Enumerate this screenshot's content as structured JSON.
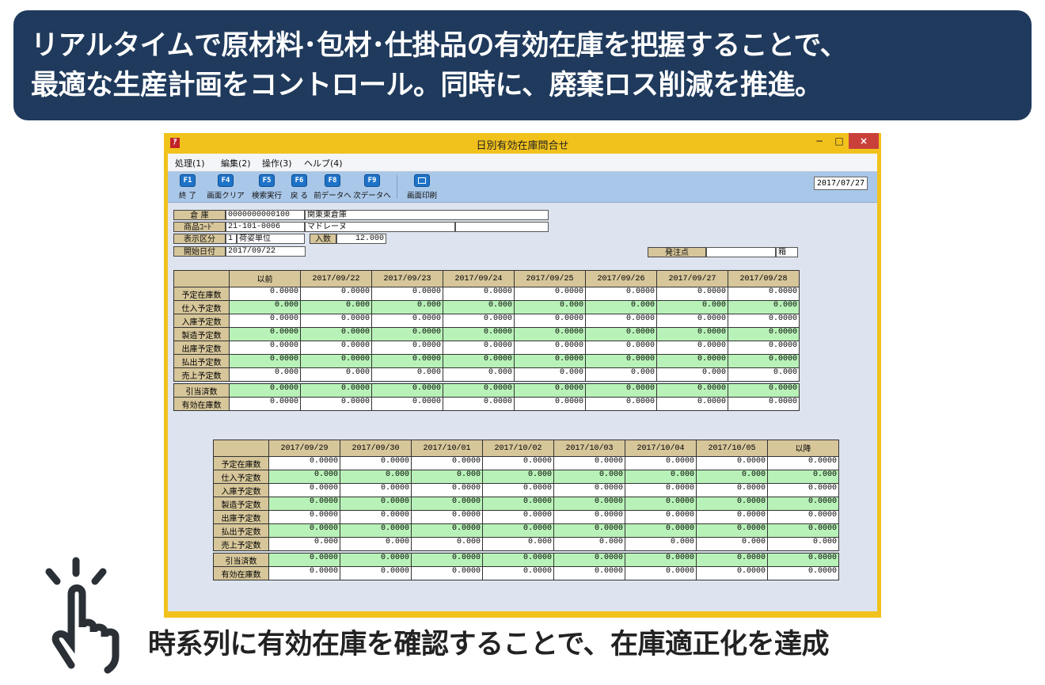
{
  "headline": {
    "line1": "リアルタイムで原材料･包材･仕掛品の有効在庫を把握することで、",
    "line2": "最適な生産計画をコントロール。同時に、廃棄ロス削減を推進。"
  },
  "window": {
    "title": "日別有効在庫問合せ",
    "app_icon": "ｱ",
    "minimize_label": "−",
    "maximize_label": "□",
    "close_label": "×",
    "menu": [
      "処理(1)",
      "編集(2)",
      "操作(3)",
      "ヘルプ(4)"
    ],
    "toolbar": [
      {
        "key": "F1",
        "label": "終 了"
      },
      {
        "key": "F4",
        "label": "画面クリア"
      },
      {
        "key": "F5",
        "label": "検索実行"
      },
      {
        "key": "F6",
        "label": "戻 る"
      },
      {
        "key": "F8",
        "label": "前データへ"
      },
      {
        "key": "F9",
        "label": "次データへ"
      }
    ],
    "print_label": "画面印刷",
    "date": "2017/07/27"
  },
  "form": {
    "warehouse_label": "倉 庫",
    "warehouse_code": "0000000000100",
    "warehouse_name": "関東東倉庫",
    "product_label": "商品ｺｰﾄﾞ",
    "product_code": "21-101-0006",
    "product_name": "マドレーヌ",
    "display_label": "表示区分",
    "display_value": "1",
    "display_text": "荷姿単位",
    "irisu_label": "入数",
    "irisu_value": "12.000",
    "start_label": "開始日付",
    "start_value": "2017/09/22",
    "order_point_label": "発注点",
    "order_point_value": "",
    "order_point_unit": "箱"
  },
  "table1": {
    "headers": [
      "以前",
      "2017/09/22",
      "2017/09/23",
      "2017/09/24",
      "2017/09/25",
      "2017/09/26",
      "2017/09/27",
      "2017/09/28"
    ],
    "rows": [
      {
        "label": "予定在庫数",
        "values": [
          "0.0000",
          "0.0000",
          "0.0000",
          "0.0000",
          "0.0000",
          "0.0000",
          "0.0000",
          "0.0000"
        ]
      },
      {
        "label": "仕入予定数",
        "values": [
          "0.000",
          "0.000",
          "0.000",
          "0.000",
          "0.000",
          "0.000",
          "0.000",
          "0.000"
        ]
      },
      {
        "label": "入庫予定数",
        "values": [
          "0.0000",
          "0.0000",
          "0.0000",
          "0.0000",
          "0.0000",
          "0.0000",
          "0.0000",
          "0.0000"
        ]
      },
      {
        "label": "製造予定数",
        "values": [
          "0.0000",
          "0.0000",
          "0.0000",
          "0.0000",
          "0.0000",
          "0.0000",
          "0.0000",
          "0.0000"
        ]
      },
      {
        "label": "出庫予定数",
        "values": [
          "0.0000",
          "0.0000",
          "0.0000",
          "0.0000",
          "0.0000",
          "0.0000",
          "0.0000",
          "0.0000"
        ]
      },
      {
        "label": "払出予定数",
        "values": [
          "0.0000",
          "0.0000",
          "0.0000",
          "0.0000",
          "0.0000",
          "0.0000",
          "0.0000",
          "0.0000"
        ]
      },
      {
        "label": "売上予定数",
        "values": [
          "0.000",
          "0.000",
          "0.000",
          "0.000",
          "0.000",
          "0.000",
          "0.000",
          "0.000"
        ]
      },
      {
        "label": "引当済数",
        "values": [
          "0.0000",
          "0.0000",
          "0.0000",
          "0.0000",
          "0.0000",
          "0.0000",
          "0.0000",
          "0.0000"
        ]
      },
      {
        "label": "有効在庫数",
        "values": [
          "0.0000",
          "0.0000",
          "0.0000",
          "0.0000",
          "0.0000",
          "0.0000",
          "0.0000",
          "0.0000"
        ]
      }
    ]
  },
  "table2": {
    "headers": [
      "2017/09/29",
      "2017/09/30",
      "2017/10/01",
      "2017/10/02",
      "2017/10/03",
      "2017/10/04",
      "2017/10/05",
      "以降"
    ],
    "rows": [
      {
        "label": "予定在庫数",
        "values": [
          "0.0000",
          "0.0000",
          "0.0000",
          "0.0000",
          "0.0000",
          "0.0000",
          "0.0000",
          "0.0000"
        ]
      },
      {
        "label": "仕入予定数",
        "values": [
          "0.000",
          "0.000",
          "0.000",
          "0.000",
          "0.000",
          "0.000",
          "0.000",
          "0.000"
        ]
      },
      {
        "label": "入庫予定数",
        "values": [
          "0.0000",
          "0.0000",
          "0.0000",
          "0.0000",
          "0.0000",
          "0.0000",
          "0.0000",
          "0.0000"
        ]
      },
      {
        "label": "製造予定数",
        "values": [
          "0.0000",
          "0.0000",
          "0.0000",
          "0.0000",
          "0.0000",
          "0.0000",
          "0.0000",
          "0.0000"
        ]
      },
      {
        "label": "出庫予定数",
        "values": [
          "0.0000",
          "0.0000",
          "0.0000",
          "0.0000",
          "0.0000",
          "0.0000",
          "0.0000",
          "0.0000"
        ]
      },
      {
        "label": "払出予定数",
        "values": [
          "0.0000",
          "0.0000",
          "0.0000",
          "0.0000",
          "0.0000",
          "0.0000",
          "0.0000",
          "0.0000"
        ]
      },
      {
        "label": "売上予定数",
        "values": [
          "0.000",
          "0.000",
          "0.000",
          "0.000",
          "0.000",
          "0.000",
          "0.000",
          "0.000"
        ]
      },
      {
        "label": "引当済数",
        "values": [
          "0.0000",
          "0.0000",
          "0.0000",
          "0.0000",
          "0.0000",
          "0.0000",
          "0.0000",
          "0.0000"
        ]
      },
      {
        "label": "有効在庫数",
        "values": [
          "0.0000",
          "0.0000",
          "0.0000",
          "0.0000",
          "0.0000",
          "0.0000",
          "0.0000",
          "0.0000"
        ]
      }
    ]
  },
  "footer": {
    "caption": "時系列に有効在庫を確認することで、在庫適正化を達成",
    "icon": "hand-pointer-icon"
  },
  "colors": {
    "headline_bg": "#1f3a5c",
    "window_frame": "#f2c21c",
    "label_bg": "#d6c69a",
    "green_row": "#b8f2b8",
    "close_button": "#c9403a",
    "toolbar_bg": "#a9c7e8"
  }
}
